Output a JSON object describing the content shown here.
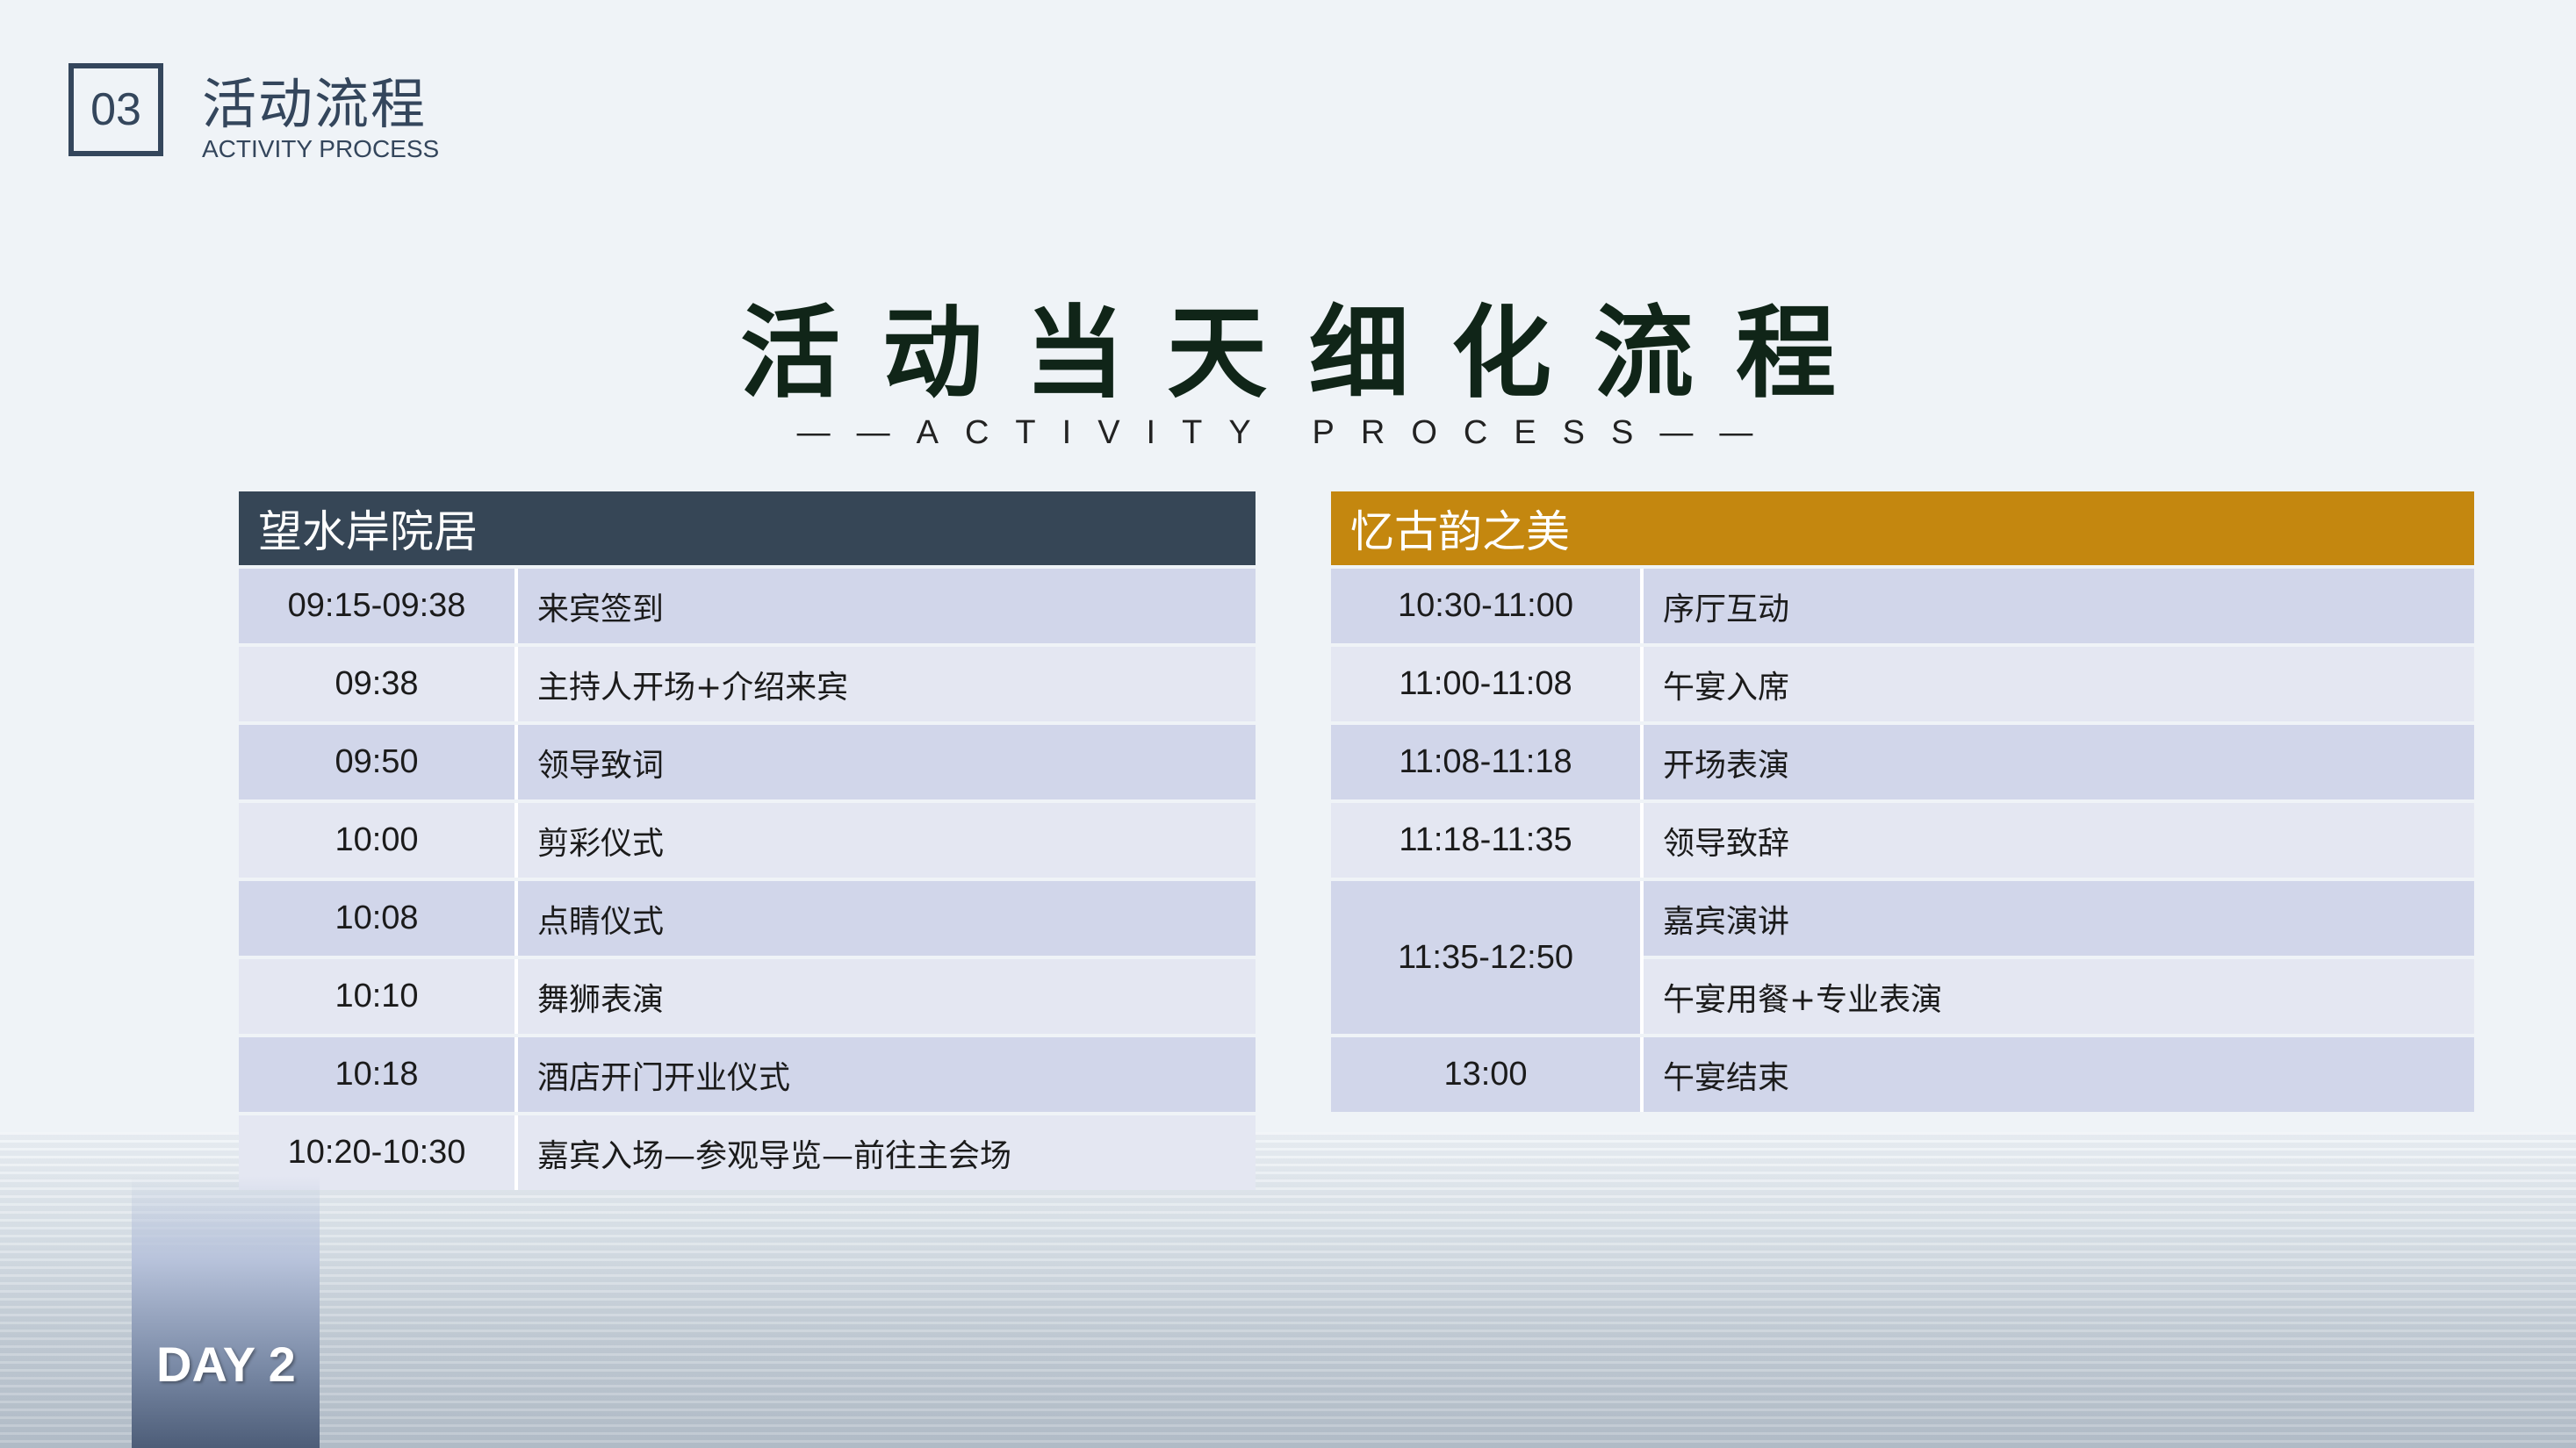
{
  "header": {
    "section_number": "03",
    "section_title": "活动流程",
    "section_subtitle": "ACTIVITY PROCESS"
  },
  "title": {
    "main": "活动当天细化流程",
    "sub": "——ACTIVITY PROCESS——"
  },
  "left_table": {
    "heading": "望水岸院居",
    "rows": [
      {
        "time": "09:15-09:38",
        "activity": "来宾签到"
      },
      {
        "time": "09:38",
        "activity": "主持人开场+介绍来宾"
      },
      {
        "time": "09:50",
        "activity": "领导致词"
      },
      {
        "time": "10:00",
        "activity": "剪彩仪式"
      },
      {
        "time": "10:08",
        "activity": "点睛仪式"
      },
      {
        "time": "10:10",
        "activity": "舞狮表演"
      },
      {
        "time": "10:18",
        "activity": "酒店开门开业仪式"
      },
      {
        "time": "10:20-10:30",
        "activity": "嘉宾入场—参观导览—前往主会场"
      }
    ]
  },
  "right_table": {
    "heading": "忆古韵之美",
    "rows": [
      {
        "time": "10:30-11:00",
        "activity": "序厅互动"
      },
      {
        "time": "11:00-11:08",
        "activity": "午宴入席"
      },
      {
        "time": "11:08-11:18",
        "activity": "开场表演"
      },
      {
        "time": "11:18-11:35",
        "activity": "领导致辞"
      },
      {
        "time": "11:35-12:50",
        "activity": "嘉宾演讲",
        "activity_2": "午宴用餐+专业表演"
      },
      {
        "time": "13:00",
        "activity": "午宴结束"
      }
    ]
  },
  "day_badge": "DAY 2",
  "colors": {
    "navy": "#364656",
    "gold": "#c4870f",
    "row_dark": "#d1d6ea",
    "row_light": "#e4e7f2"
  }
}
